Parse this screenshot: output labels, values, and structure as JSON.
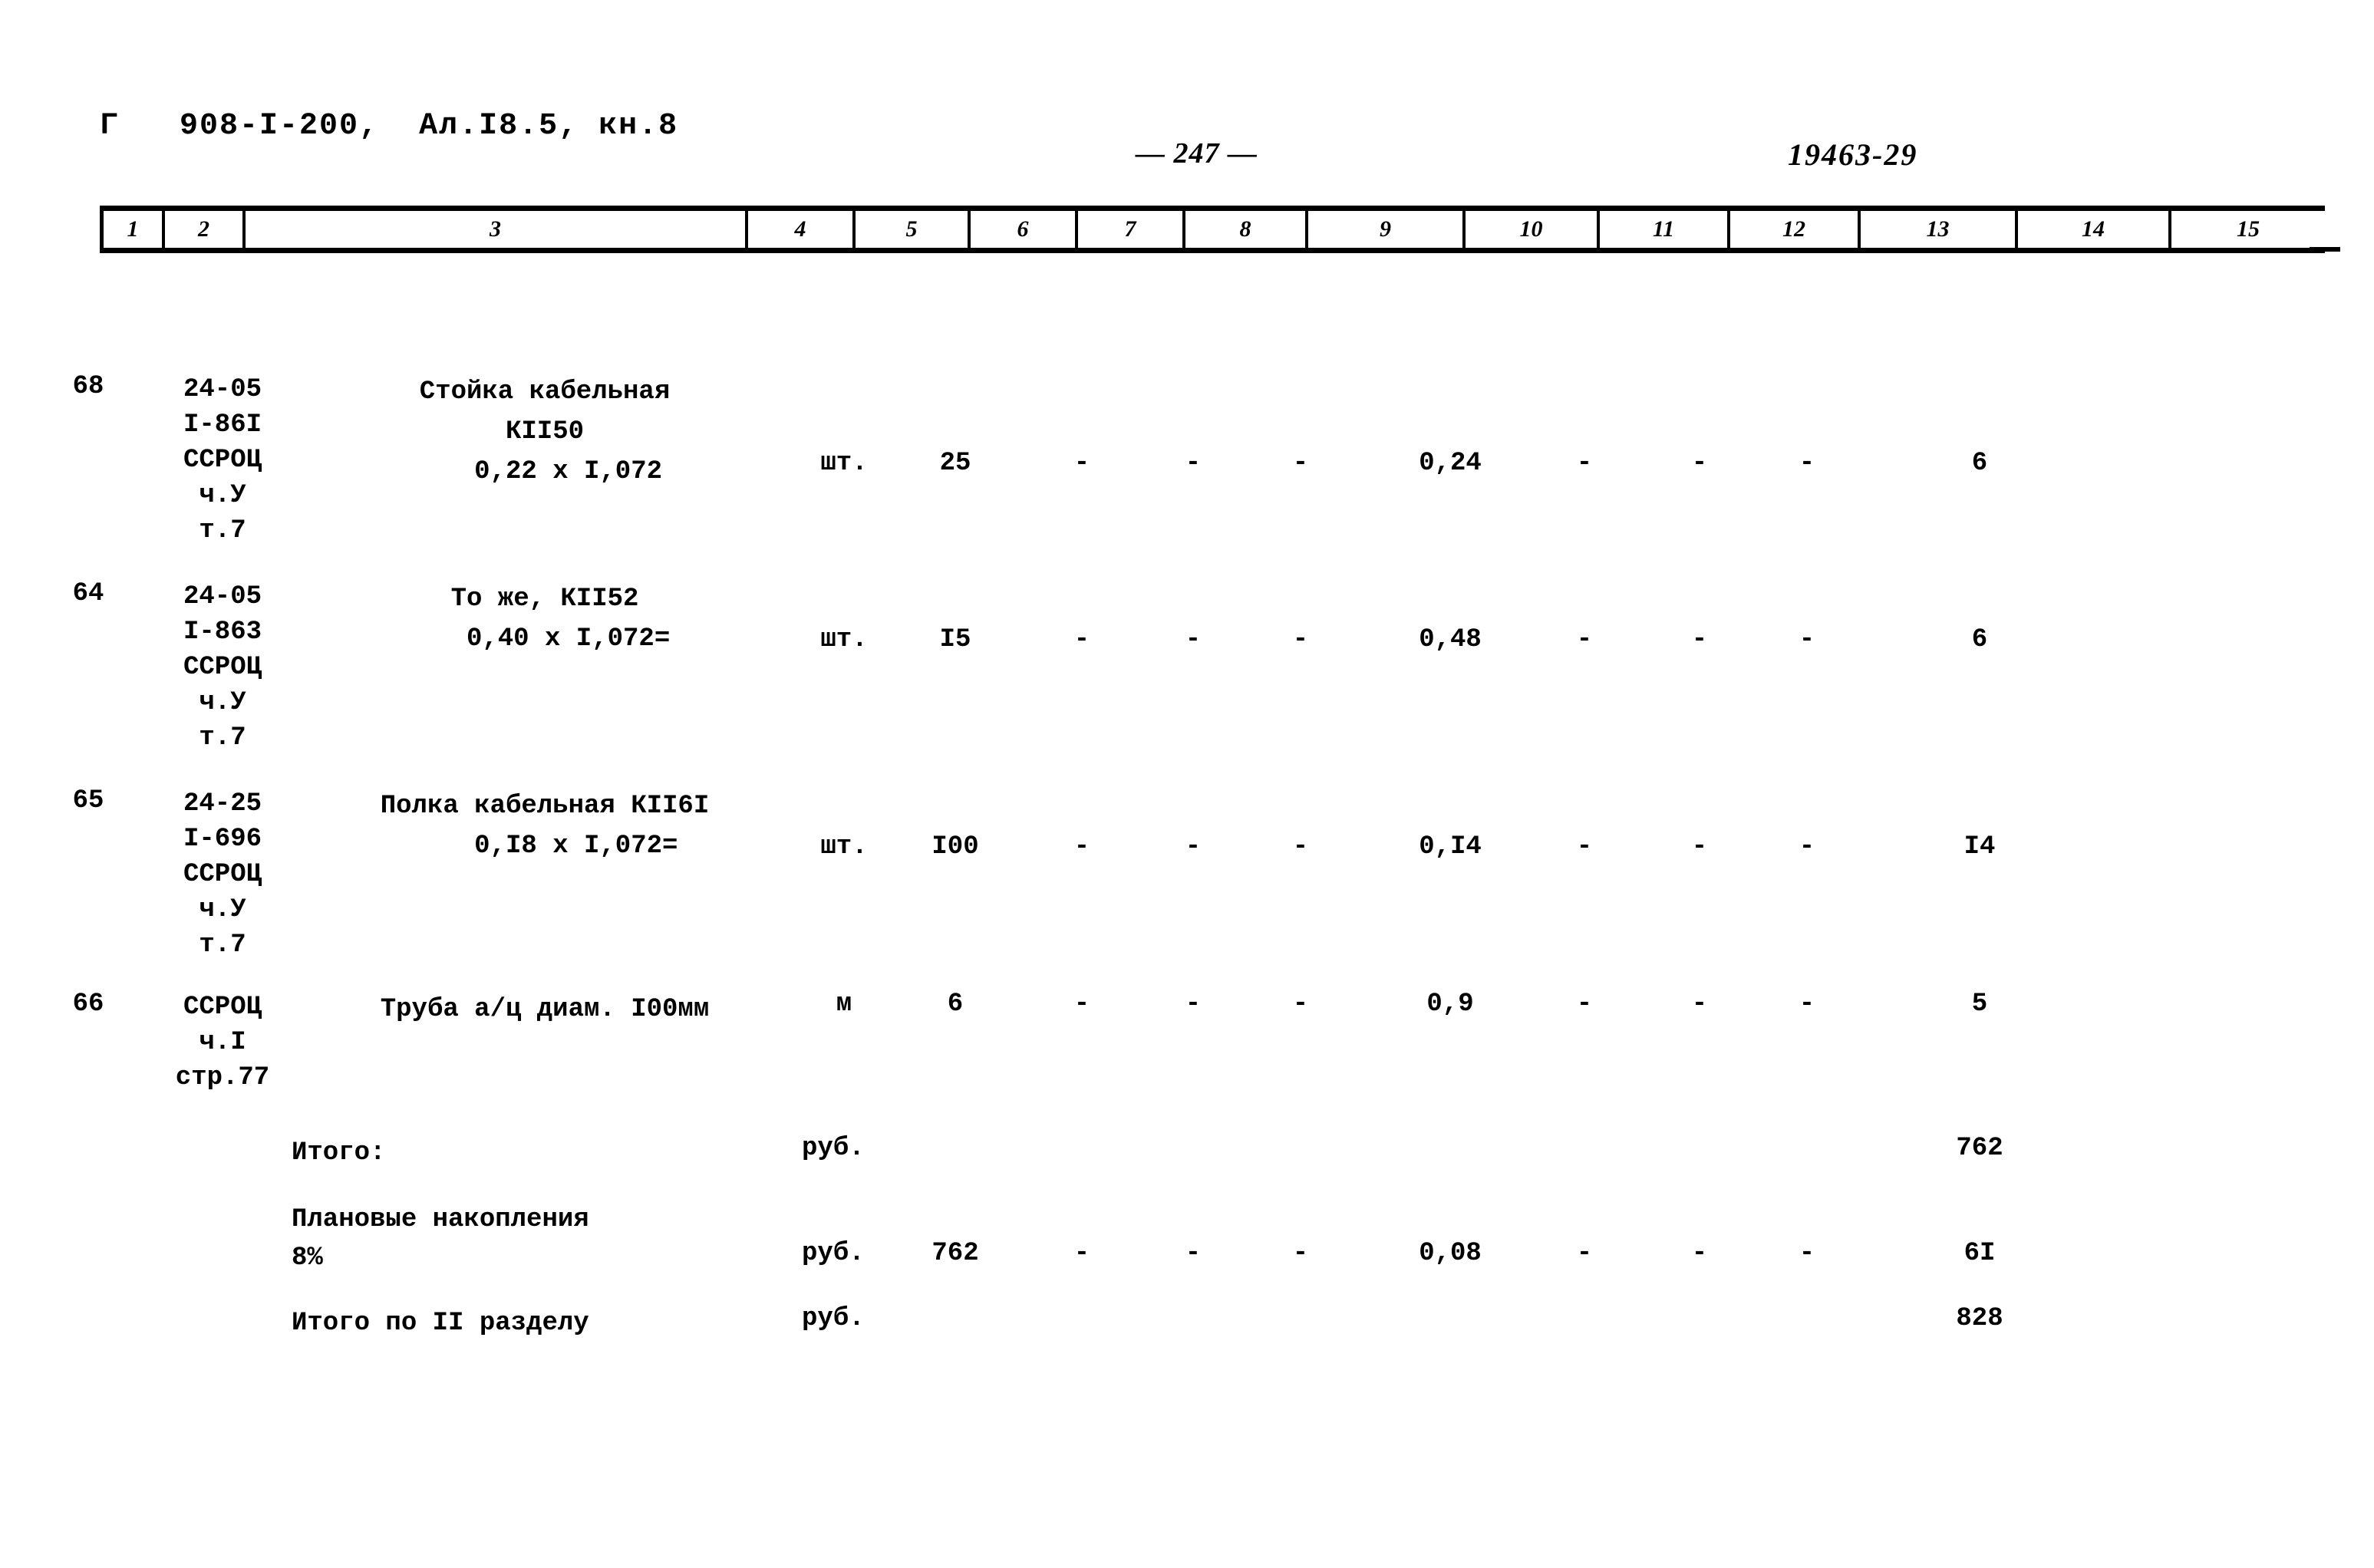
{
  "document": {
    "heading": "Г   908-I-200,  Ал.I8.5, кн.8",
    "page_number": "— 247 —",
    "doc_code": "19463-29"
  },
  "table": {
    "column_headers": [
      "1",
      "2",
      "3",
      "4",
      "5",
      "6",
      "7",
      "8",
      "9",
      "10",
      "11",
      "12",
      "13",
      "14",
      "15"
    ],
    "rows": [
      {
        "num": "68",
        "code": "24-05\nI-86I\nССРОЦ\nч.У\nт.7",
        "desc": "Стойка кабельная\nКII50\n   0,22 х I,072",
        "unit": "шт.",
        "c5": "25",
        "c6": "-",
        "c7": "-",
        "c8": "-",
        "c9": "0,24",
        "c10": "-",
        "c11": "-",
        "c12": "-",
        "c13": "6"
      },
      {
        "num": "64",
        "code": "24-05\nI-863\nССРОЦ\nч.У\nт.7",
        "desc": "То же, КII52\n   0,40 х I,072=",
        "unit": "шт.",
        "c5": "I5",
        "c6": "-",
        "c7": "-",
        "c8": "-",
        "c9": "0,48",
        "c10": "-",
        "c11": "-",
        "c12": "-",
        "c13": "6"
      },
      {
        "num": "65",
        "code": "24-25\nI-696\nССРОЦ\nч.У\nт.7",
        "desc": "Полка кабельная КII6I\n    0,I8 х I,072=",
        "unit": "шт.",
        "c5": "I00",
        "c6": "-",
        "c7": "-",
        "c8": "-",
        "c9": "0,I4",
        "c10": "-",
        "c11": "-",
        "c12": "-",
        "c13": "I4"
      },
      {
        "num": "66",
        "code": "ССРОЦ\nч.I\nстр.77",
        "desc": "Труба а/ц диам. I00мм",
        "unit": "м",
        "c5": "6",
        "c6": "-",
        "c7": "-",
        "c8": "-",
        "c9": "0,9",
        "c10": "-",
        "c11": "-",
        "c12": "-",
        "c13": "5"
      }
    ],
    "summary_rows": [
      {
        "label": "Итого:",
        "unit": "руб.",
        "c5": "",
        "c6": "",
        "c7": "",
        "c8": "",
        "c9": "",
        "c10": "",
        "c11": "",
        "c12": "",
        "c13": "762"
      },
      {
        "label": "Плановые накопления\n8%",
        "unit": "руб.",
        "c5": "762",
        "c6": "-",
        "c7": "-",
        "c8": "-",
        "c9": "0,08",
        "c10": "-",
        "c11": "-",
        "c12": "-",
        "c13": "6I"
      },
      {
        "label": "Итого по II разделу",
        "unit": "руб.",
        "c5": "",
        "c6": "",
        "c7": "",
        "c8": "",
        "c9": "",
        "c10": "",
        "c11": "",
        "c12": "",
        "c13": "828"
      }
    ]
  }
}
